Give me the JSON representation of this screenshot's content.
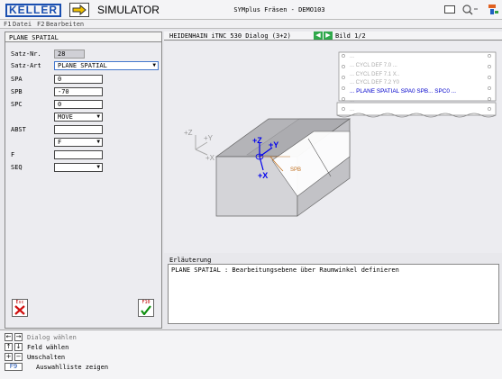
{
  "titlebar": {
    "logo": "KELLER",
    "simulator": "SIMULATOR",
    "app_title": "SYMplus Fräsen - DEMO103"
  },
  "menubar": {
    "items": [
      {
        "key": "F1",
        "label": "Datei"
      },
      {
        "key": "F2",
        "label": "Bearbeiten"
      }
    ]
  },
  "form": {
    "heading": "PLANE SPATIAL",
    "satz_nr_label": "Satz-Nr.",
    "satz_nr_value": "28",
    "satz_art_label": "Satz-Art",
    "satz_art_value": "PLANE SPATIAL",
    "spa_label": "SPA",
    "spa_value": "0",
    "spb_label": "SPB",
    "spb_value": "-70",
    "spc_label": "SPC",
    "spc_value": "0",
    "move_value": "MOVE",
    "abst_label": "ABST",
    "abst_value": "",
    "f_select_value": "F",
    "f_label": "F",
    "f_value": "",
    "seq_label": "SEQ",
    "seq_value": "",
    "esc_label": "Esc",
    "f10_label": "F10"
  },
  "dialog": {
    "title": "HEIDENHAIN iTNC 530 Dialog (3+2)",
    "bild": "Bild 1/2"
  },
  "nc_listing": {
    "lines": [
      "...",
      "... CYCL DEF 7.0 ...",
      "... CYCL DEF 7.1 X..",
      "... CYCL DEF 7.2 Y0",
      "... PLANE SPATIAL SPA0 SPB... SPC0 ...",
      "...",
      "..."
    ]
  },
  "diagram": {
    "axis_z": "+Z",
    "axis_y": "+Y",
    "axis_x": "+X",
    "spb_label": "SPB"
  },
  "explanation": {
    "label": "Erläuterung",
    "text": "PLANE SPATIAL : Bearbeitungsebene über Raumwinkel definieren"
  },
  "help": {
    "items": [
      {
        "keys": [
          "←",
          "→"
        ],
        "text": "Dialog wählen"
      },
      {
        "keys": [
          "↑",
          "↓"
        ],
        "text": "Feld wählen"
      },
      {
        "keys": [
          "+",
          "−"
        ],
        "text": "Umschalten"
      },
      {
        "keys": [
          "F9"
        ],
        "text": "Auswahlliste zeigen"
      }
    ]
  },
  "colors": {
    "accent_blue": "#1a4fb0",
    "nav_green": "#2fa84a",
    "highlight_blue": "#0000cc",
    "spb_orange": "#c07020"
  }
}
